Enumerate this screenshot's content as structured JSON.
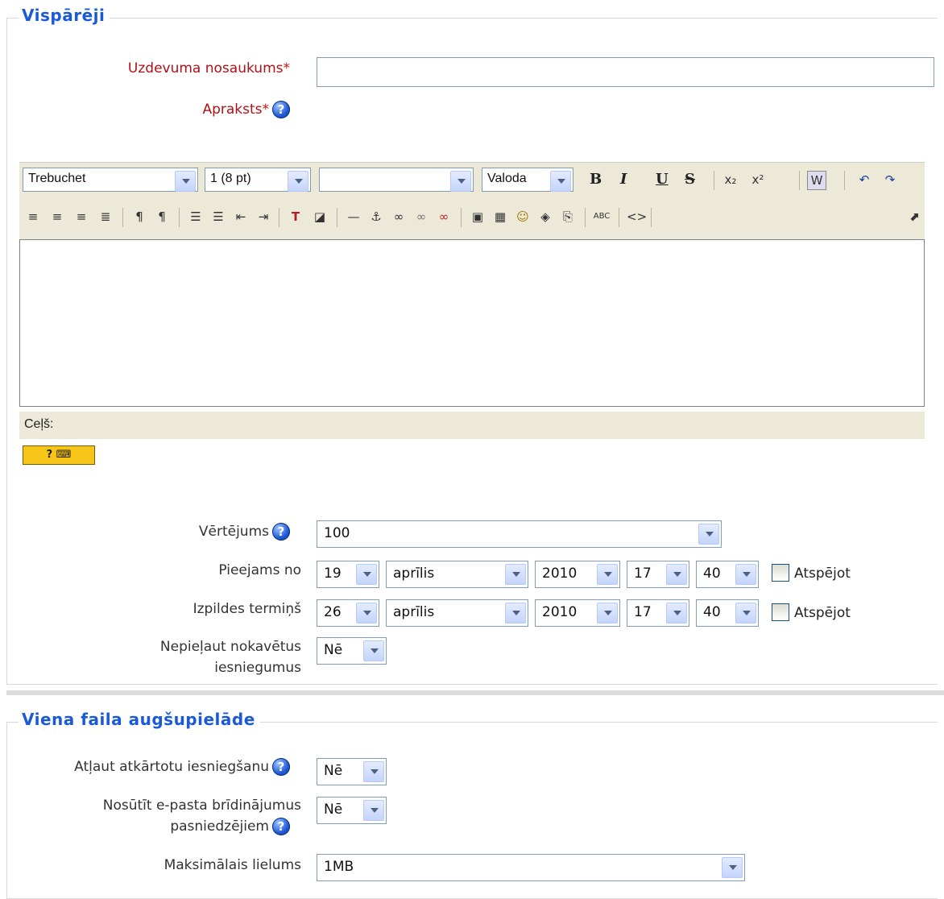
{
  "general": {
    "legend": "Vispārēji",
    "title_label": "Uzdevuma nosaukums",
    "title_value": "",
    "desc_label": "Apraksts",
    "required_mark": "*",
    "help_glyph": "?"
  },
  "editor": {
    "font": "Trebuchet",
    "size": "1 (8 pt)",
    "format": "",
    "language": "Valoda",
    "path_label": "Ceļš:",
    "kbd_help": "? ⌨"
  },
  "grade": {
    "label": "Vērtējums",
    "value": "100"
  },
  "available_from": {
    "label": "Pieejams no",
    "day": "19",
    "month": "aprīlis",
    "year": "2010",
    "hour": "17",
    "minute": "40",
    "disable_label": "Atspējot"
  },
  "due_date": {
    "label": "Izpildes termiņš",
    "day": "26",
    "month": "aprīlis",
    "year": "2010",
    "hour": "17",
    "minute": "40",
    "disable_label": "Atspējot"
  },
  "prevent_late": {
    "label_line1": "Nepieļaut nokavētus",
    "label_line2": "iesniegumus",
    "value": "Nē"
  },
  "upload": {
    "legend": "Viena faila augšupielāde",
    "resubmit_label": "Atļaut atkārtotu iesniegšanu",
    "resubmit_value": "Nē",
    "email_label_line1": "Nosūtīt e-pasta brīdinājumus",
    "email_label_line2": "pasniedzējiem",
    "email_value": "Nē",
    "maxsize_label": "Maksimālais lielums",
    "maxsize_value": "1MB"
  }
}
